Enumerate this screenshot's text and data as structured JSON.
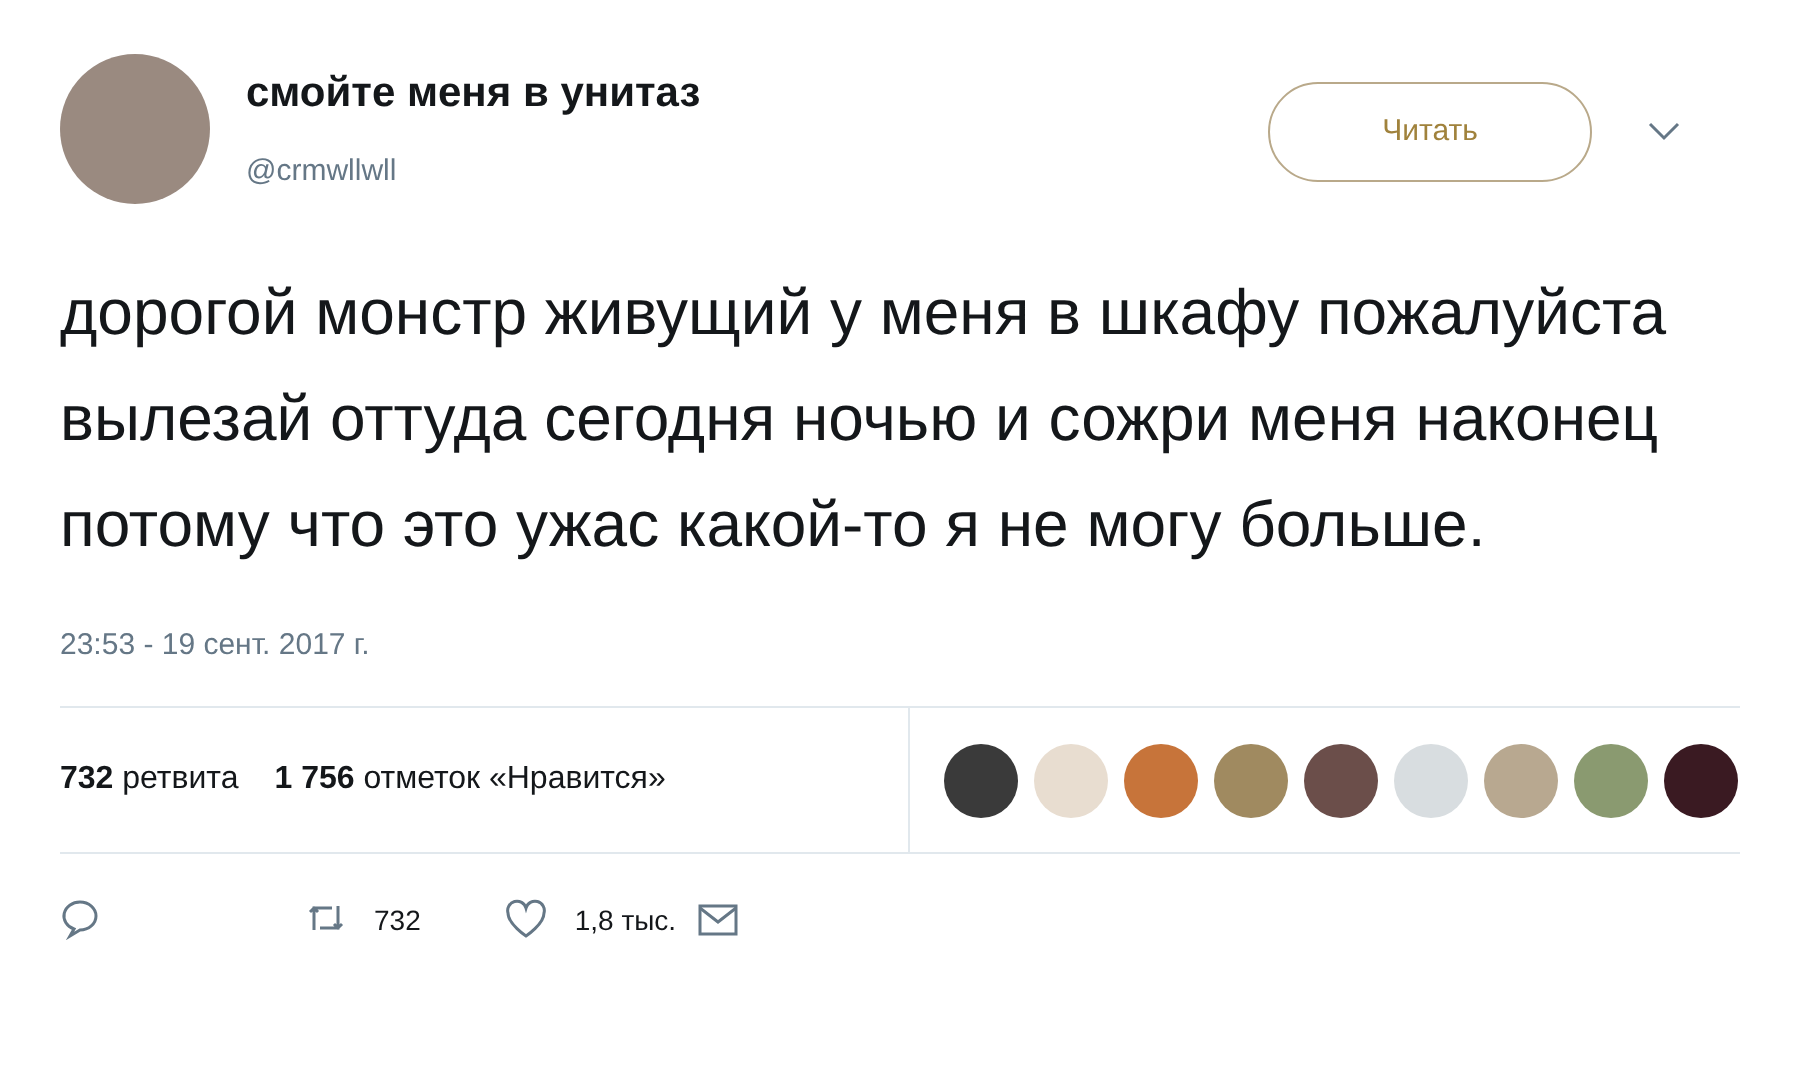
{
  "author": {
    "name": "смойте меня в унитаз",
    "handle": "@crmwllwll"
  },
  "follow_button": "Читать",
  "tweet_text": "дорогой монстр живущий у меня в шкафу пожалуйста вылезай оттуда сегодня ночью и сожри меня наконец потому что это ужас какой-то я не могу больше.",
  "timestamp": "23:53 - 19 сент. 2017 г.",
  "stats": [
    {
      "count": "732",
      "label": "ретвита"
    },
    {
      "count": "1 756",
      "label": "отметок «Нравится»"
    }
  ],
  "liker_avatars": [
    {
      "color": "#3a3a3a"
    },
    {
      "color": "#e8ddd0"
    },
    {
      "color": "#c7743a"
    },
    {
      "color": "#a08a60"
    },
    {
      "color": "#6b4e4a"
    },
    {
      "color": "#d8dde0"
    },
    {
      "color": "#b8a890"
    },
    {
      "color": "#8a9a70"
    },
    {
      "color": "#3a1a22"
    }
  ],
  "actions": [
    {
      "kind": "reply"
    },
    {
      "kind": "retweet",
      "count": "732"
    },
    {
      "kind": "like",
      "count": "1,8 тыс."
    },
    {
      "kind": "message"
    }
  ]
}
